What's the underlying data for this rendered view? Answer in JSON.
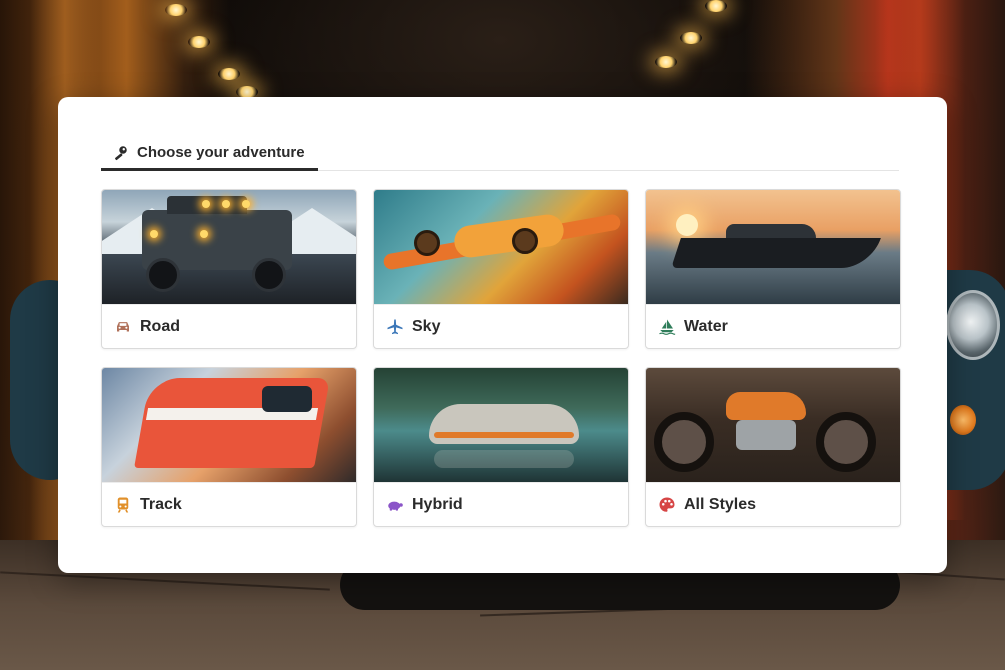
{
  "tabs": [
    {
      "label": "Choose your adventure",
      "icon": "key-icon",
      "active": true
    }
  ],
  "categories": [
    {
      "id": "road",
      "label": "Road",
      "icon": "car-icon",
      "icon_color": "#b0715a"
    },
    {
      "id": "sky",
      "label": "Sky",
      "icon": "airplane-icon",
      "icon_color": "#3b77b8"
    },
    {
      "id": "water",
      "label": "Water",
      "icon": "sailboat-icon",
      "icon_color": "#2f7d5a"
    },
    {
      "id": "track",
      "label": "Track",
      "icon": "train-icon",
      "icon_color": "#e1902a"
    },
    {
      "id": "hybrid",
      "label": "Hybrid",
      "icon": "turtle-icon",
      "icon_color": "#8b55c8"
    },
    {
      "id": "styles",
      "label": "All Styles",
      "icon": "palette-icon",
      "icon_color": "#d64545"
    }
  ]
}
